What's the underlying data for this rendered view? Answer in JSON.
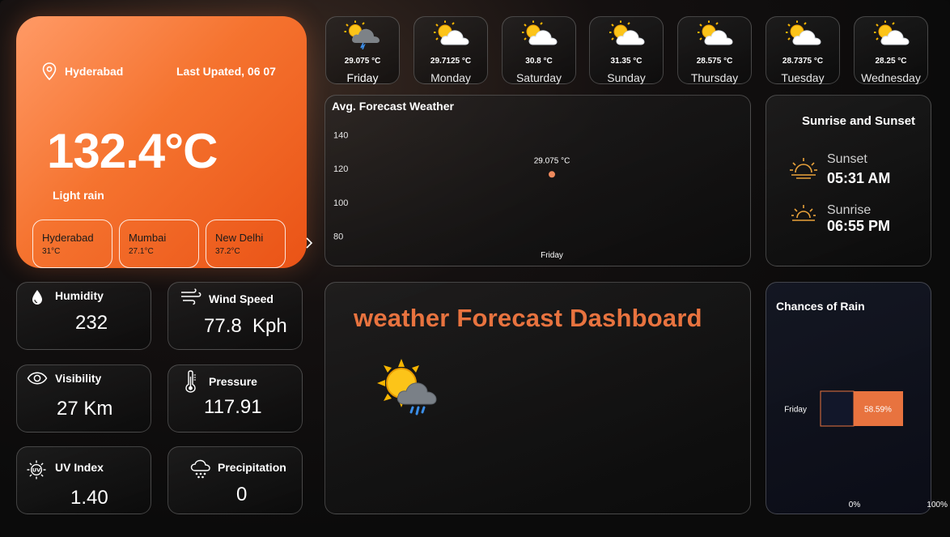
{
  "hero": {
    "city": "Hyderabad",
    "last_updated": "Last Upated, 06 07",
    "temperature": "132.4°C",
    "condition": "Light rain",
    "cities": [
      {
        "name": "Hyderabad",
        "temp": "31°C"
      },
      {
        "name": "Mumbai",
        "temp": "27.1°C"
      },
      {
        "name": "New Delhi",
        "temp": "37.2°C"
      }
    ]
  },
  "metrics": {
    "humidity": {
      "label": "Humidity",
      "value": "232"
    },
    "wind": {
      "label": "Wind Speed",
      "value": "77.8  Kph"
    },
    "visibility": {
      "label": "Visibility",
      "value": "27 Km"
    },
    "pressure": {
      "label": "Pressure",
      "value": "117.91"
    },
    "uv": {
      "label": "UV Index",
      "value": "1.40"
    },
    "precipitation": {
      "label": "Precipitation",
      "value": "0"
    }
  },
  "forecast": [
    {
      "day": "Friday",
      "temp": "29.075 °C",
      "icon": "rain-cloud-sun-icon"
    },
    {
      "day": "Monday",
      "temp": "29.7125 °C",
      "icon": "partly-cloudy-icon"
    },
    {
      "day": "Saturday",
      "temp": "30.8 °C",
      "icon": "partly-cloudy-icon"
    },
    {
      "day": "Sunday",
      "temp": "31.35 °C",
      "icon": "partly-cloudy-icon"
    },
    {
      "day": "Thursday",
      "temp": "28.575 °C",
      "icon": "partly-cloudy-icon"
    },
    {
      "day": "Tuesday",
      "temp": "28.7375 °C",
      "icon": "partly-cloudy-icon"
    },
    {
      "day": "Wednesday",
      "temp": "28.25 °C",
      "icon": "partly-cloudy-icon"
    }
  ],
  "avg_chart": {
    "title": "Avg. Forecast Weather",
    "point_label": "29.075 °C"
  },
  "sun": {
    "title": "Sunrise and Sunset",
    "sunset_label": "Sunset",
    "sunset_time": "05:31 AM",
    "sunrise_label": "Sunrise",
    "sunrise_time": "06:55 PM"
  },
  "dashboard_title": "weather Forecast Dashboard",
  "rain_chart": {
    "title": "Chances of Rain",
    "bar_label": "58.59%",
    "x_min_label": "0%",
    "x_max_label": "100%"
  },
  "colors": {
    "accent": "#e8733f",
    "hero_start": "#ff9a66",
    "hero_end": "#ea5316"
  },
  "chart_data": [
    {
      "type": "scatter",
      "title": "Avg. Forecast Weather",
      "categories": [
        "Friday"
      ],
      "values": [
        116.6
      ],
      "data_labels": [
        "29.075 °C"
      ],
      "yticks": [
        140,
        120,
        100,
        80
      ],
      "ylim": [
        74,
        147
      ]
    },
    {
      "type": "bar",
      "orientation": "horizontal",
      "title": "Chances of Rain",
      "categories": [
        "Friday"
      ],
      "values": [
        58.59
      ],
      "xlim": [
        0,
        100
      ],
      "xticks": [
        "0%",
        "100%"
      ]
    }
  ]
}
